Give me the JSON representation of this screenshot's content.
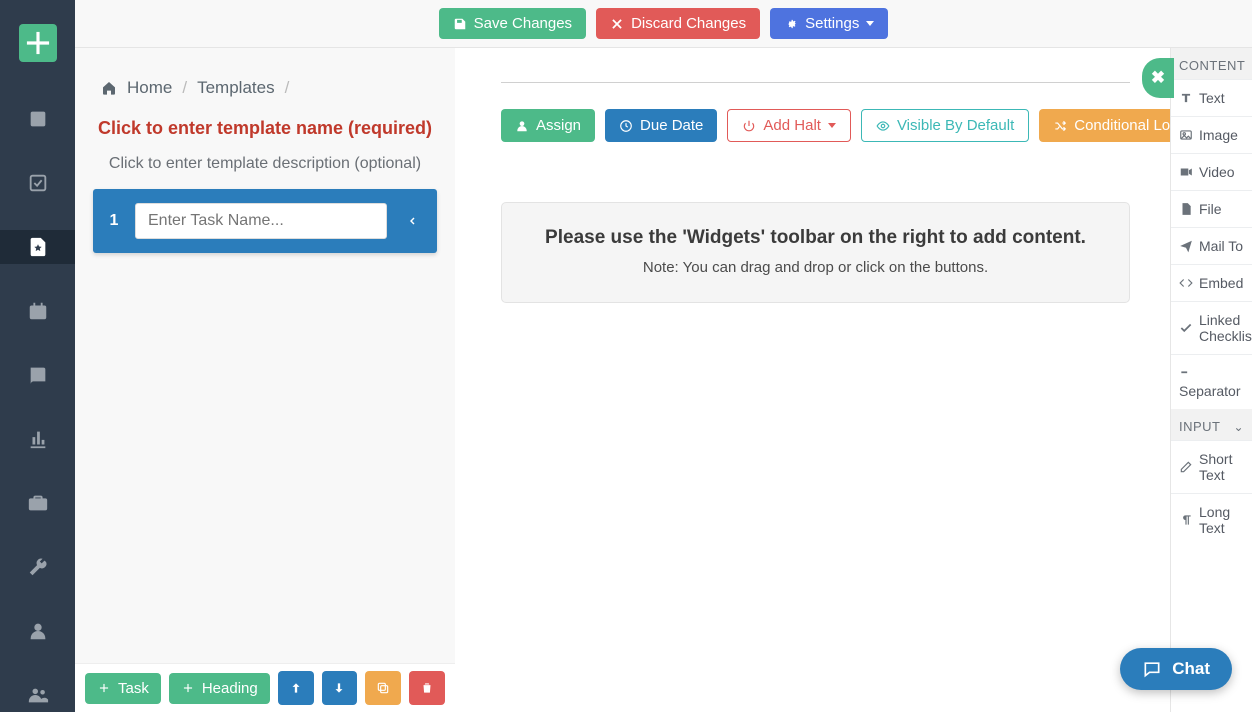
{
  "topbar": {
    "save": "Save Changes",
    "discard": "Discard Changes",
    "settings": "Settings"
  },
  "breadcrumb": {
    "home": "Home",
    "templates": "Templates"
  },
  "template": {
    "name_placeholder": "Click to enter template name (required)",
    "desc_placeholder": "Click to enter template description (optional)"
  },
  "task": {
    "number": "1",
    "placeholder": "Enter Task Name..."
  },
  "actions": {
    "assign": "Assign",
    "due_date": "Due Date",
    "add_halt": "Add Halt",
    "visible": "Visible By Default",
    "conditional": "Conditional Logic"
  },
  "empty_state": {
    "title": "Please use the 'Widgets' toolbar on the right to add content.",
    "note": "Note: You can drag and drop or click on the buttons."
  },
  "bottom": {
    "task": "Task",
    "heading": "Heading"
  },
  "panel": {
    "content_header": "CONTENT",
    "input_header": "INPUT",
    "items_content": [
      {
        "icon": "text",
        "label": "Text"
      },
      {
        "icon": "image",
        "label": "Image"
      },
      {
        "icon": "video",
        "label": "Video"
      },
      {
        "icon": "file",
        "label": "File"
      },
      {
        "icon": "mail",
        "label": "Mail To"
      },
      {
        "icon": "embed",
        "label": "Embed"
      },
      {
        "icon": "check",
        "label": "Linked Checklist"
      },
      {
        "icon": "sep",
        "label": "Separator"
      }
    ],
    "items_input": [
      {
        "icon": "short",
        "label": "Short Text"
      },
      {
        "icon": "long",
        "label": "Long Text"
      }
    ]
  },
  "chat": {
    "label": "Chat"
  }
}
